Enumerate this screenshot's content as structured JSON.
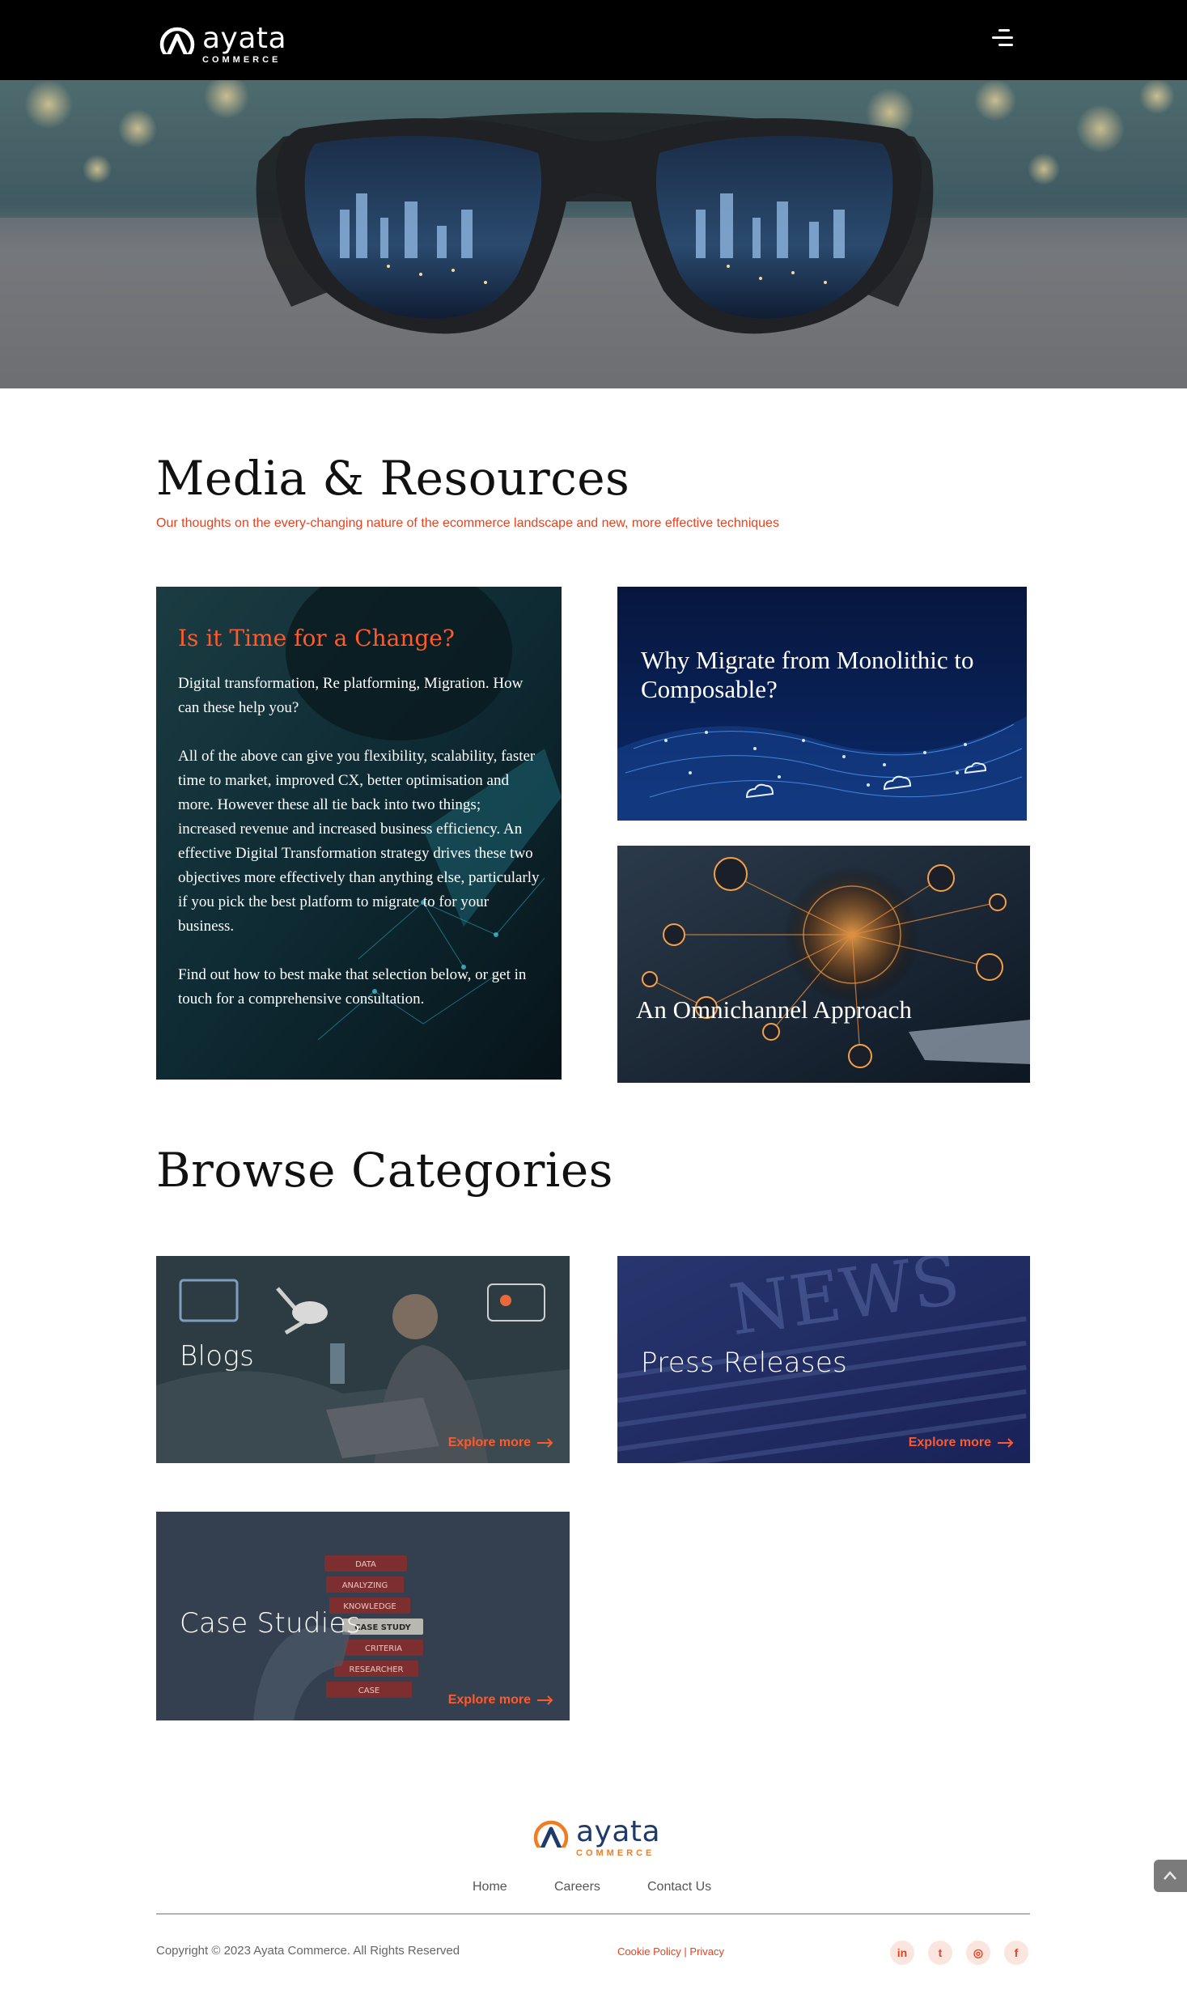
{
  "brand": {
    "name": "ayata",
    "tagline": "COMMERCE",
    "accent": "#e8411e",
    "secondary": "#ef7d22",
    "navy": "#1d3a6b"
  },
  "header": {
    "menu_icon": "hamburger-menu-icon"
  },
  "hero": {
    "image": "eyeglasses-city-lights-photo"
  },
  "media": {
    "title": "Media & Resources",
    "subtitle": "Our thoughts on the every-changing nature of the ecommerce landscape and new, more effective techniques"
  },
  "intro": {
    "heading": "Is it Time for a Change?",
    "p1": "Digital transformation, Re platforming, Migration. How can these help you?",
    "p2": "All of the above can give you flexibility, scalability, faster time to market, improved CX, better optimisation and more. However these all tie back into two things; increased revenue and increased business efficiency. An effective Digital Transformation strategy drives these two objectives more effectively than anything else, particularly if you pick the best platform to migrate to for your business.",
    "p3": "Find out how to best make that selection below, or get in touch for a comprehensive consultation."
  },
  "articles": [
    {
      "title": "Why Migrate from Monolithic to Composable?"
    },
    {
      "title": "An Omnichannel Approach"
    }
  ],
  "browse": {
    "title": "Browse Categories",
    "explore_label": "Explore more",
    "categories": [
      {
        "label": "Blogs"
      },
      {
        "label": "Press Releases"
      },
      {
        "label": "Case Studies",
        "image_words": [
          "DATA",
          "ANALYZING",
          "KNOWLEDGE",
          "CASE STUDY",
          "CRITERIA",
          "RESEARCHER",
          "CASE"
        ]
      }
    ]
  },
  "footer": {
    "nav": [
      "Home",
      "Careers",
      "Contact Us"
    ],
    "copyright": "Copyright © 2023 Ayata Commerce. All Rights Reserved",
    "cookie_policy": "Cookie Policy",
    "separator": "|",
    "privacy": "Privacy",
    "social": [
      {
        "icon": "linkedin-icon",
        "glyph": "in"
      },
      {
        "icon": "twitter-icon",
        "glyph": "t"
      },
      {
        "icon": "instagram-icon",
        "glyph": "◎"
      },
      {
        "icon": "facebook-icon",
        "glyph": "f"
      }
    ]
  }
}
